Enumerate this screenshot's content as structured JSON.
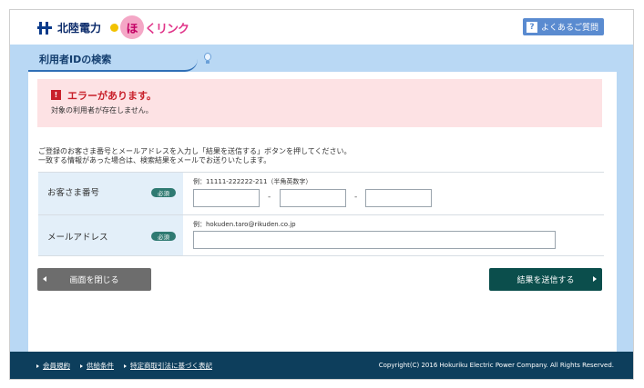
{
  "header": {
    "logo_text": "北陸電力",
    "service_logo": {
      "circle": "ほ",
      "rest": "くリンク"
    },
    "faq_icon": "?",
    "faq_label": "よくあるご質問"
  },
  "page_title": "利用者IDの検索",
  "error": {
    "icon": "!",
    "title": "エラーがあります。",
    "message": "対象の利用者が存在しません。"
  },
  "intro": {
    "line1": "ご登録のお客さま番号とメールアドレスを入力し「結果を送信する」ボタンを押してください。",
    "line2": "一致する情報があった場合は、検索結果をメールでお送りいたします。"
  },
  "form": {
    "customer_number": {
      "label": "お客さま番号",
      "required": "必須",
      "hint": "例：11111-222222-211（半角英数字）",
      "values": [
        "",
        "",
        ""
      ],
      "separator": "-"
    },
    "email": {
      "label": "メールアドレス",
      "required": "必須",
      "hint": "例：hokuden.taro@rikuden.co.jp",
      "value": ""
    }
  },
  "buttons": {
    "close": "画面を閉じる",
    "send": "結果を送信する"
  },
  "footer": {
    "links": [
      "会員規約",
      "供給条件",
      "特定商取引法に基づく表記"
    ],
    "copyright": "Copyright(C) 2016 Hokuriku Electric Power Company. All Rights Reserved."
  },
  "colors": {
    "accent_blue": "#b9d8f4",
    "error_bg": "#fde2e4",
    "error_red": "#c8202a",
    "send_button": "#0b4e4c",
    "close_button": "#6d6d6d",
    "footer_bg": "#0d3e5c"
  }
}
